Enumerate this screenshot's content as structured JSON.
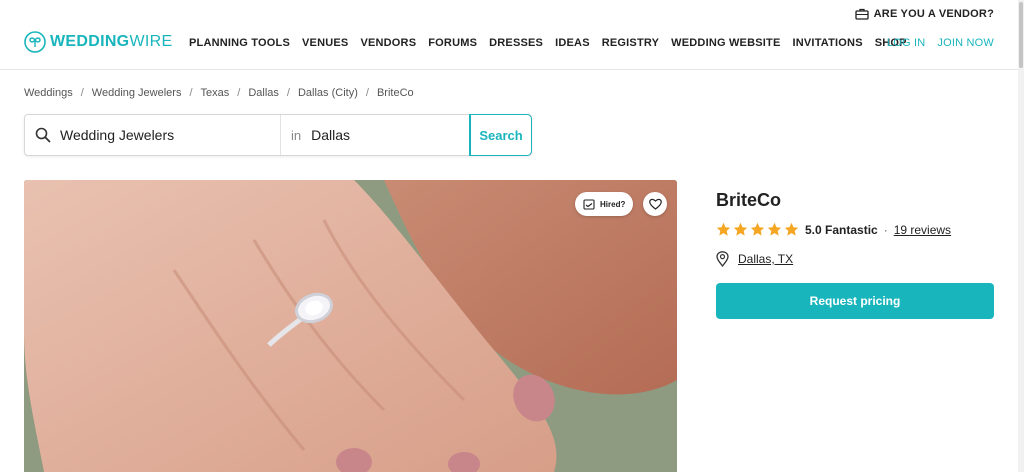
{
  "header": {
    "vendor_cta": "ARE YOU A VENDOR?",
    "logo": {
      "bold": "WEDDING",
      "light": "WIRE"
    },
    "nav": [
      "PLANNING TOOLS",
      "VENUES",
      "VENDORS",
      "FORUMS",
      "DRESSES",
      "IDEAS",
      "REGISTRY",
      "WEDDING WEBSITE",
      "INVITATIONS",
      "SHOP"
    ],
    "login": "LOG IN",
    "join": "JOIN NOW"
  },
  "breadcrumb": [
    "Weddings",
    "Wedding Jewelers",
    "Texas",
    "Dallas",
    "Dallas (City)",
    "BriteCo"
  ],
  "search": {
    "category": "Wedding Jewelers",
    "in_label": "in",
    "location": "Dallas",
    "button": "Search"
  },
  "photo": {
    "hired_label": "Hired?"
  },
  "vendor": {
    "name": "BriteCo",
    "stars": 5,
    "score_text": "5.0 Fantastic",
    "separator": "·",
    "reviews_text": "19 reviews",
    "location": "Dallas, TX",
    "cta": "Request pricing"
  },
  "colors": {
    "brand": "#19b5bc",
    "star": "#f5a623"
  }
}
